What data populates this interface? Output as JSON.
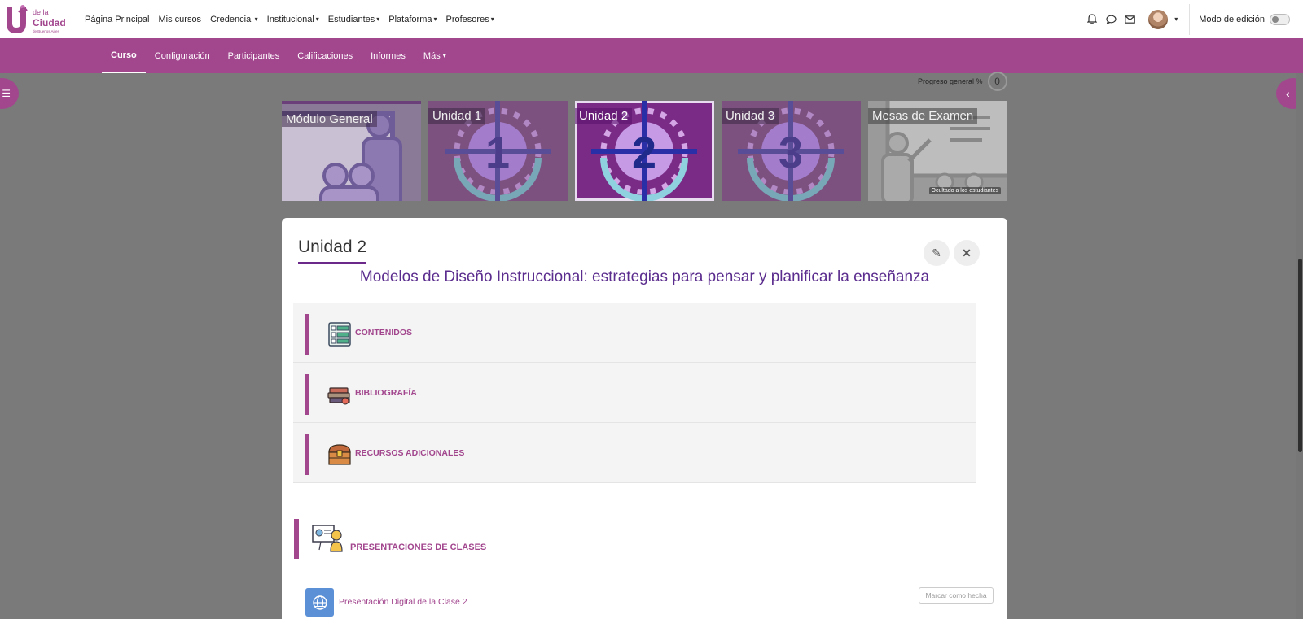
{
  "logo": {
    "line1": "de la",
    "line2": "Ciudad",
    "line3": "de Buenos Aires",
    "icon": "logo-u-icon"
  },
  "topnav": {
    "items": [
      {
        "label": "Página Principal",
        "dropdown": false
      },
      {
        "label": "Mis cursos",
        "dropdown": false
      },
      {
        "label": "Credencial",
        "dropdown": true
      },
      {
        "label": "Institucional",
        "dropdown": true
      },
      {
        "label": "Estudiantes",
        "dropdown": true
      },
      {
        "label": "Plataforma",
        "dropdown": true
      },
      {
        "label": "Profesores",
        "dropdown": true
      }
    ],
    "icons": [
      "bell-icon",
      "chat-icon",
      "envelope-icon"
    ],
    "edit_mode_label": "Modo de edición"
  },
  "secnav": {
    "items": [
      {
        "label": "Curso",
        "active": true,
        "dropdown": false
      },
      {
        "label": "Configuración",
        "active": false,
        "dropdown": false
      },
      {
        "label": "Participantes",
        "active": false,
        "dropdown": false
      },
      {
        "label": "Calificaciones",
        "active": false,
        "dropdown": false
      },
      {
        "label": "Informes",
        "active": false,
        "dropdown": false
      },
      {
        "label": "Más",
        "active": false,
        "dropdown": true
      }
    ]
  },
  "progress": {
    "label": "Progreso general %",
    "value": "0"
  },
  "tiles": [
    {
      "label": "Módulo General",
      "number": "",
      "kind": "general"
    },
    {
      "label": "Unidad 1",
      "number": "1",
      "kind": "unit"
    },
    {
      "label": "Unidad 2",
      "number": "2",
      "kind": "unit-active"
    },
    {
      "label": "Unidad 3",
      "number": "3",
      "kind": "unit"
    },
    {
      "label": "Mesas de Examen",
      "number": "",
      "kind": "exam",
      "note": "Ocultado a los estudiantes"
    }
  ],
  "card": {
    "title": "Unidad 2",
    "subtitle": "Modelos de Diseño Instruccional: estrategias para pensar y planificar la enseñanza",
    "sections": [
      {
        "label": "CONTENIDOS",
        "icon": "checklist-icon"
      },
      {
        "label": "BIBLIOGRAFÍA",
        "icon": "books-icon"
      },
      {
        "label": "RECURSOS ADICIONALES",
        "icon": "treasure-chest-icon"
      }
    ],
    "presentations_label": "PRESENTACIONES DE CLASES",
    "activity": {
      "label": "Presentación Digital de la Clase 2",
      "icon": "globe-icon"
    },
    "mark_done": "Marcar como hecha"
  },
  "colors": {
    "primary": "#a2468e",
    "title_purple": "#5b2d8e",
    "underline": "#6b2a8a"
  }
}
